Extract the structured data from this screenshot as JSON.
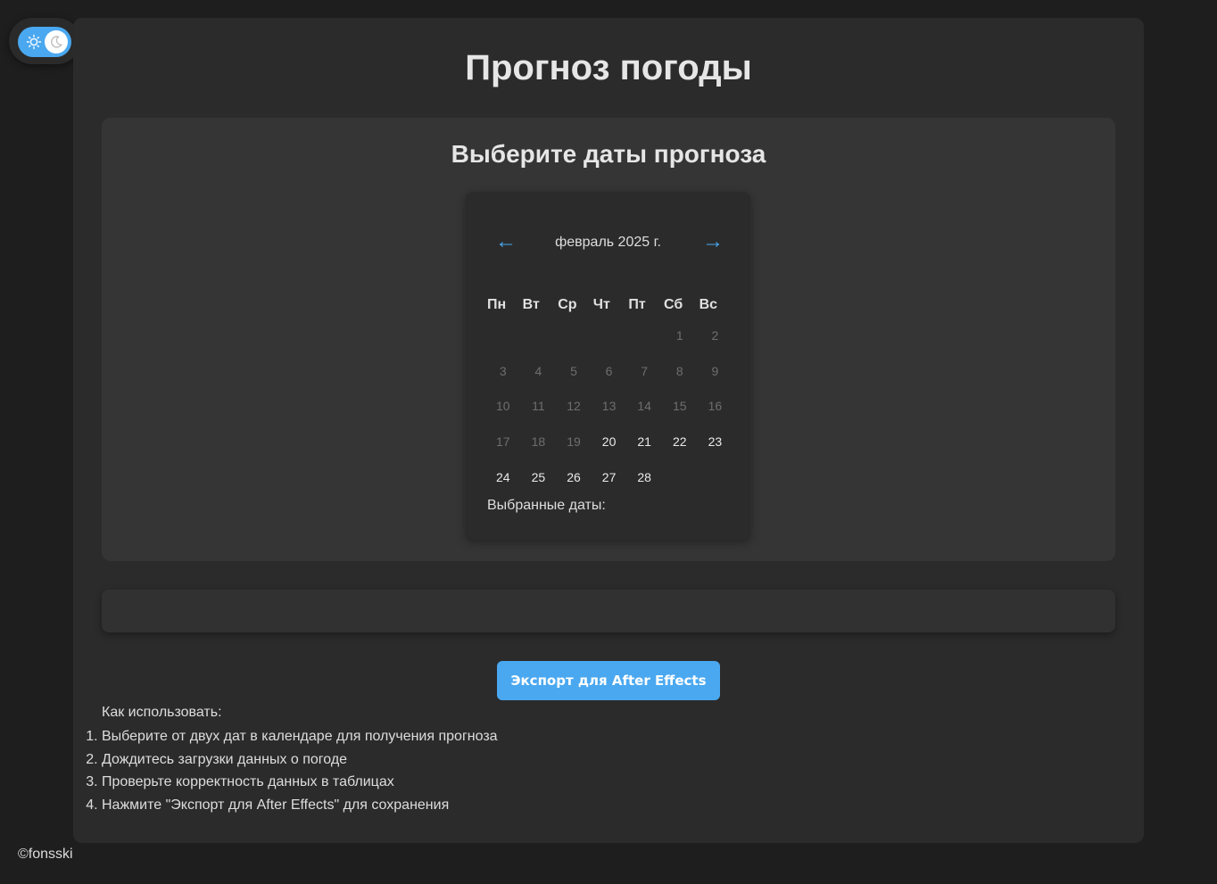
{
  "theme_toggle": {
    "state": "dark",
    "icons": [
      "sun-icon",
      "moon-icon"
    ]
  },
  "page": {
    "title": "Прогноз погоды"
  },
  "date_picker": {
    "title": "Выберите даты прогноза",
    "prev_label": "←",
    "next_label": "→",
    "month": "февраль 2025 г.",
    "weekdays": [
      "Пн",
      "Вт",
      "Ср",
      "Чт",
      "Пт",
      "Сб",
      "Вс"
    ],
    "leading_blanks": 5,
    "days_in_month": 28,
    "first_selectable_day": 20,
    "selected_label": "Выбранные даты:"
  },
  "export": {
    "label": "Экспорт для After Effects"
  },
  "instructions": {
    "title": "Как использовать:",
    "steps": [
      "Выберите от двух дат в календаре для получения прогноза",
      "Дождитесь загрузки данных о погоде",
      "Проверьте корректность данных в таблицах",
      "Нажмите \"Экспорт для After Effects\" для сохранения"
    ]
  },
  "footer": {
    "text": "©fonsski"
  },
  "colors": {
    "accent": "#4aa8f0",
    "background": "#1e1e1e",
    "container": "#2b2b2b",
    "panel": "#353535",
    "disabled_day": "#6e6e6e"
  }
}
